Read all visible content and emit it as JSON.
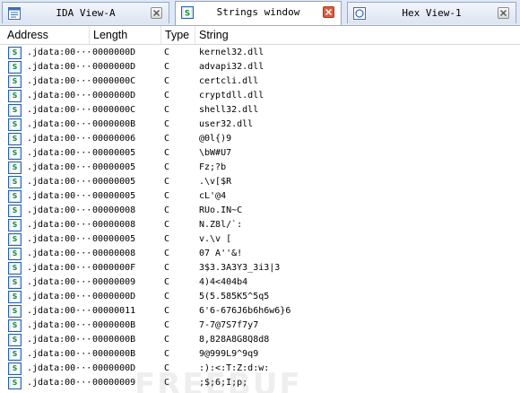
{
  "tabs": [
    {
      "title": "IDA View-A",
      "active": false,
      "icon": "ida-view-icon"
    },
    {
      "title": "Strings window",
      "active": true,
      "icon": "strings-icon"
    },
    {
      "title": "Hex View-1",
      "active": false,
      "icon": "hex-view-icon"
    }
  ],
  "columns": {
    "address": "Address",
    "length": "Length",
    "type": "Type",
    "string": "String"
  },
  "rows": [
    {
      "address": ".jdata:00···",
      "length": "0000000D",
      "type": "C",
      "string": "kernel32.dll"
    },
    {
      "address": ".jdata:00···",
      "length": "0000000D",
      "type": "C",
      "string": "advapi32.dll"
    },
    {
      "address": ".jdata:00···",
      "length": "0000000C",
      "type": "C",
      "string": "certcli.dll"
    },
    {
      "address": ".jdata:00···",
      "length": "0000000D",
      "type": "C",
      "string": "cryptdll.dll"
    },
    {
      "address": ".jdata:00···",
      "length": "0000000C",
      "type": "C",
      "string": "shell32.dll"
    },
    {
      "address": ".jdata:00···",
      "length": "0000000B",
      "type": "C",
      "string": "user32.dll"
    },
    {
      "address": ".jdata:00···",
      "length": "00000006",
      "type": "C",
      "string": "@0l{)9"
    },
    {
      "address": ".jdata:00···",
      "length": "00000005",
      "type": "C",
      "string": "\\bW#U7"
    },
    {
      "address": ".jdata:00···",
      "length": "00000005",
      "type": "C",
      "string": "Fz;?b"
    },
    {
      "address": ".jdata:00···",
      "length": "00000005",
      "type": "C",
      "string": ".\\v[$R"
    },
    {
      "address": ".jdata:00···",
      "length": "00000005",
      "type": "C",
      "string": "cL'@4"
    },
    {
      "address": ".jdata:00···",
      "length": "00000008",
      "type": "C",
      "string": "RUo.IN~C"
    },
    {
      "address": ".jdata:00···",
      "length": "00000008",
      "type": "C",
      "string": "N.Z8l/`:"
    },
    {
      "address": ".jdata:00···",
      "length": "00000005",
      "type": "C",
      "string": "v.\\v ["
    },
    {
      "address": ".jdata:00···",
      "length": "00000008",
      "type": "C",
      "string": "07 A''&!"
    },
    {
      "address": ".jdata:00···",
      "length": "0000000F",
      "type": "C",
      "string": "3$3.3A3Y3_3i3|3"
    },
    {
      "address": ".jdata:00···",
      "length": "00000009",
      "type": "C",
      "string": "4)4<404b4"
    },
    {
      "address": ".jdata:00···",
      "length": "0000000D",
      "type": "C",
      "string": "5(5.585K5^5q5"
    },
    {
      "address": ".jdata:00···",
      "length": "00000011",
      "type": "C",
      "string": "6'6-676J6b6h6w6}6"
    },
    {
      "address": ".jdata:00···",
      "length": "0000000B",
      "type": "C",
      "string": "7-7@7S7f7y7"
    },
    {
      "address": ".jdata:00···",
      "length": "0000000B",
      "type": "C",
      "string": "8,828A8G8Q8d8"
    },
    {
      "address": ".jdata:00···",
      "length": "0000000B",
      "type": "C",
      "string": "9@999L9^9q9"
    },
    {
      "address": ".jdata:00···",
      "length": "0000000D",
      "type": "C",
      "string": ":):<:T:Z:d:w:"
    },
    {
      "address": ".jdata:00···",
      "length": "00000009",
      "type": "C",
      "string": ";$;6;I;p;"
    }
  ],
  "watermark": "FREEBUF",
  "colors": {
    "tab_bar": "#dfe8f6",
    "active_close": "#e35a3c",
    "string_icon_green": "#1c8a3a",
    "icon_border": "#2a5fa8"
  }
}
